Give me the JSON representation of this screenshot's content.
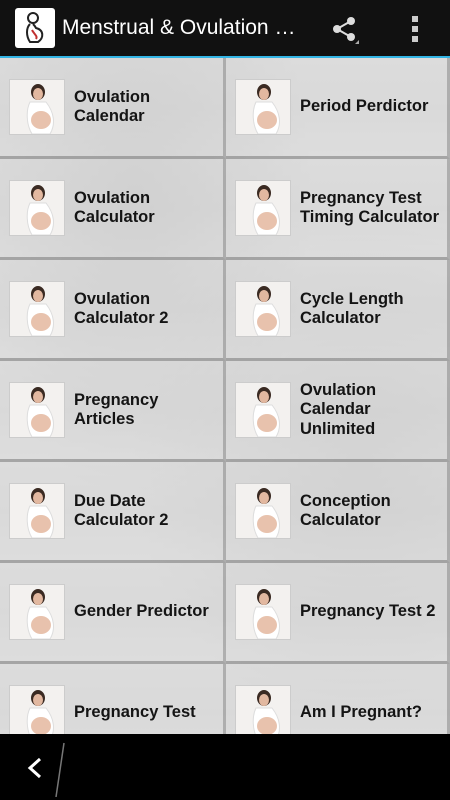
{
  "app": {
    "title": "Menstrual & Ovulation Calendar",
    "icon": "pregnant-woman-logo-icon"
  },
  "actionbar": {
    "share_icon": "share-icon",
    "overflow_icon": "overflow-menu-icon"
  },
  "tiles": [
    {
      "label": "Ovulation Calendar",
      "thumb": "pregnant-woman-photo"
    },
    {
      "label": "Period Perdictor",
      "thumb": "pregnant-woman-photo"
    },
    {
      "label": "Ovulation Calculator",
      "thumb": "pregnant-woman-photo"
    },
    {
      "label": "Pregnancy Test Timing Calculator",
      "thumb": "pregnant-woman-photo"
    },
    {
      "label": "Ovulation Calculator 2",
      "thumb": "pregnant-woman-photo"
    },
    {
      "label": "Cycle Length Calculator",
      "thumb": "pregnant-woman-photo"
    },
    {
      "label": "Pregnancy Articles",
      "thumb": "pregnant-woman-photo"
    },
    {
      "label": "Ovulation Calendar Unlimited",
      "thumb": "pregnant-woman-photo"
    },
    {
      "label": "Due Date Calculator 2",
      "thumb": "pregnant-woman-photo"
    },
    {
      "label": "Conception Calculator",
      "thumb": "pregnant-woman-photo"
    },
    {
      "label": "Gender Predictor",
      "thumb": "pregnant-woman-photo"
    },
    {
      "label": "Pregnancy Test 2",
      "thumb": "pregnant-woman-photo"
    },
    {
      "label": "Pregnancy Test",
      "thumb": "pregnant-woman-photo"
    },
    {
      "label": "Am I Pregnant?",
      "thumb": "pregnant-woman-photo"
    }
  ],
  "navbar": {
    "back_icon": "back-arrow-icon"
  },
  "colors": {
    "actionbar_bg": "#111111",
    "actionbar_accent": "#33b5e5",
    "tile_text": "#141414",
    "navbar_bg": "#000000"
  }
}
